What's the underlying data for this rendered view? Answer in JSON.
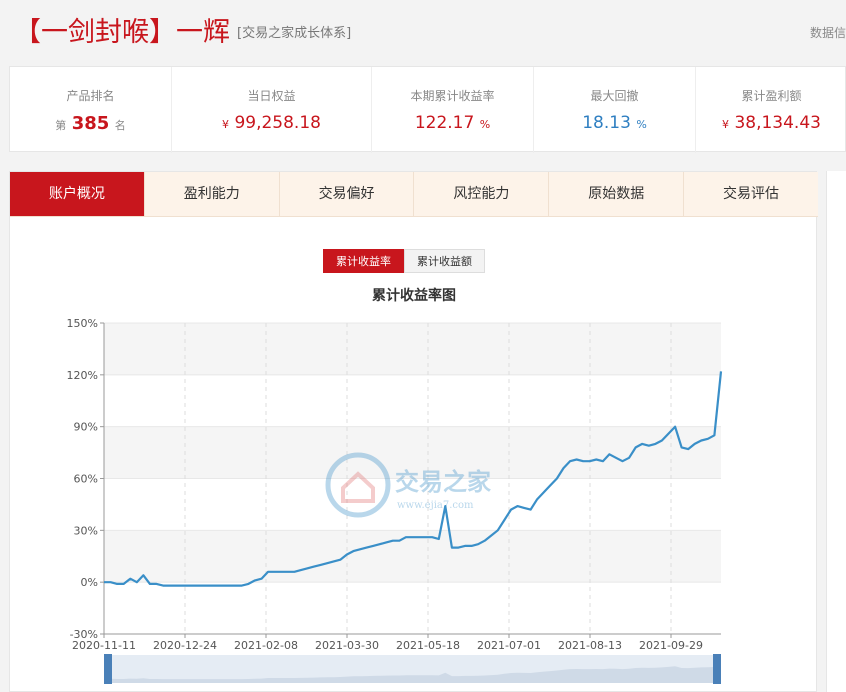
{
  "header": {
    "title": "【一剑封喉】一辉",
    "subtitle": "[交易之家成长体系]",
    "right_link": "数据信"
  },
  "stats": [
    {
      "label": "产品排名",
      "prefix": "第",
      "value": "385",
      "suffix": "名"
    },
    {
      "label": "当日权益",
      "prefix": "¥",
      "value": "99,258.18",
      "suffix": ""
    },
    {
      "label": "本期累计收益率",
      "prefix": "",
      "value": "122.17",
      "suffix": "%"
    },
    {
      "label": "最大回撤",
      "prefix": "",
      "value": "18.13",
      "suffix": "%"
    },
    {
      "label": "累计盈利额",
      "prefix": "¥",
      "value": "38,134.43",
      "suffix": ""
    }
  ],
  "tabs": [
    "账户概况",
    "盈利能力",
    "交易偏好",
    "风控能力",
    "原始数据",
    "交易评估"
  ],
  "toggle": [
    "累计收益率",
    "累计收益额"
  ],
  "watermark": {
    "cn": "交易之家",
    "url": "www.ejia7.com"
  },
  "colors": {
    "accent": "#c8161d",
    "line": "#3a8fc8",
    "blue_value": "#2f7fc1"
  },
  "chart_data": {
    "type": "line",
    "title": "累计收益率图",
    "y_ticks": [
      "150%",
      "120%",
      "90%",
      "60%",
      "30%",
      "0%",
      "-30%"
    ],
    "ylim": [
      -30,
      150
    ],
    "x_ticks": [
      "2020-11-11",
      "2020-12-24",
      "2021-02-08",
      "2021-03-30",
      "2021-05-18",
      "2021-07-01",
      "2021-08-13",
      "2021-09-29"
    ],
    "grid": true,
    "series": [
      {
        "values": [
          0,
          0,
          -1,
          -1,
          2,
          0,
          4,
          -1,
          -1,
          -2,
          -2,
          -2,
          -2,
          -2,
          -2,
          -2,
          -2,
          -2,
          -2,
          -2,
          -2,
          -2,
          -1,
          1,
          2,
          6,
          6,
          6,
          6,
          6,
          7,
          8,
          9,
          10,
          11,
          12,
          13,
          16,
          18,
          19,
          20,
          21,
          22,
          23,
          24,
          24,
          26,
          26,
          26,
          26,
          26,
          25,
          44,
          20,
          20,
          21,
          21,
          22,
          24,
          27,
          30,
          36,
          42,
          44,
          43,
          42,
          48,
          52,
          56,
          60,
          66,
          70,
          71,
          70,
          70,
          71,
          70,
          74,
          72,
          70,
          72,
          78,
          80,
          79,
          80,
          82,
          86,
          90,
          78,
          77,
          80,
          82,
          83,
          85,
          122
        ]
      }
    ]
  }
}
